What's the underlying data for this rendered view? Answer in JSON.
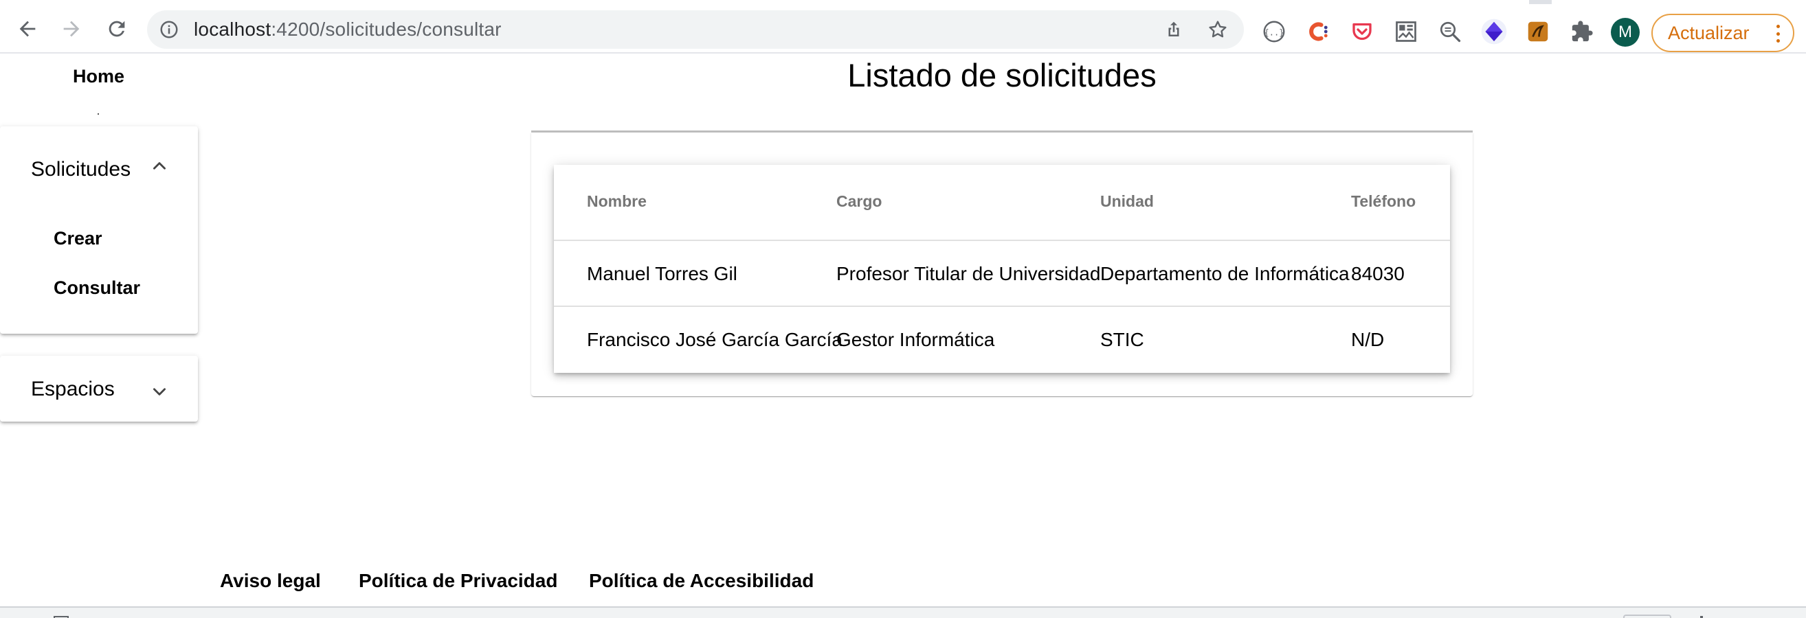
{
  "browser": {
    "url_host": "localhost",
    "url_path": ":4200/solicitudes/consultar",
    "profile_initial": "M",
    "update_label": "Actualizar",
    "colors": {
      "update_accent": "#d56e0c",
      "profile_bg": "#0b5c4e"
    }
  },
  "nav": {
    "home_label": "Home",
    "sections": [
      {
        "label": "Solicitudes",
        "expanded": true,
        "items": [
          {
            "label": "Crear"
          },
          {
            "label": "Consultar"
          }
        ]
      },
      {
        "label": "Espacios",
        "expanded": false,
        "items": []
      }
    ]
  },
  "main": {
    "title": "Listado de solicitudes",
    "table": {
      "columns": [
        "Nombre",
        "Cargo",
        "Unidad",
        "Teléfono"
      ],
      "rows": [
        [
          "Manuel Torres Gil",
          "Profesor Titular de Universidad",
          "Departamento de Informática",
          "84030"
        ],
        [
          "Francisco José García García",
          "Gestor Informática",
          "STIC",
          "N/D"
        ]
      ]
    }
  },
  "footer": {
    "links": [
      "Aviso legal",
      "Política de Privacidad",
      "Política de Accesibilidad"
    ]
  }
}
